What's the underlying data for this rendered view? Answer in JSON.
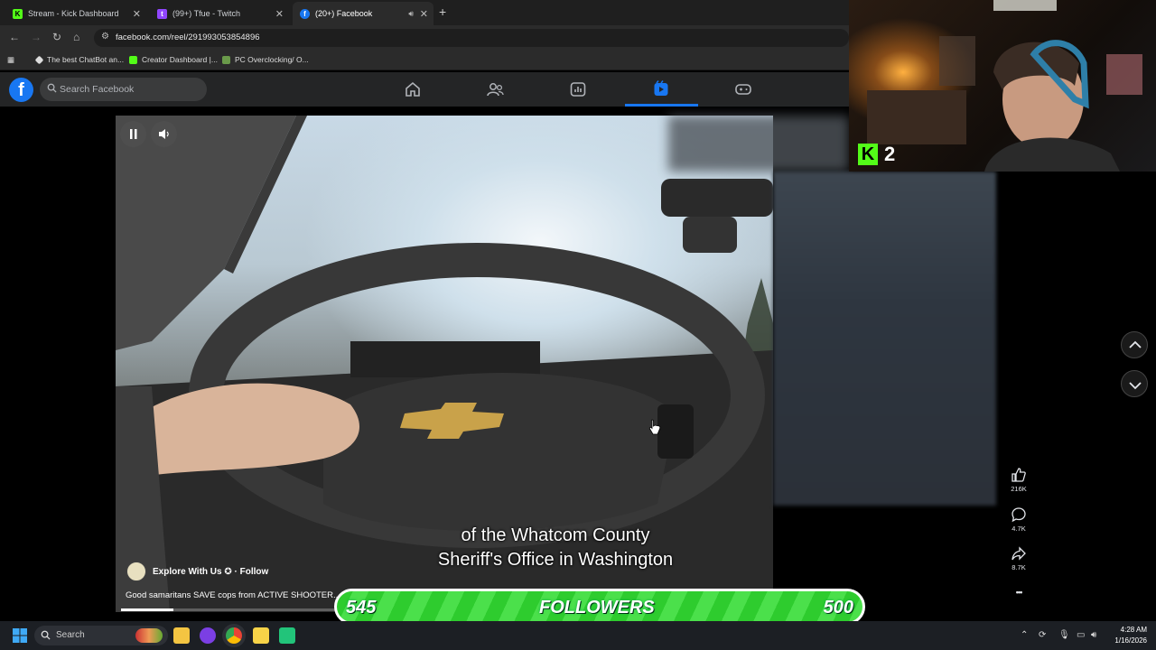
{
  "browser": {
    "tabs": [
      {
        "label": "Stream - Kick Dashboard",
        "favicon_color": "#53fc18"
      },
      {
        "label": "(99+) Tfue - Twitch",
        "favicon_color": "#9146ff"
      },
      {
        "label": "(20+) Facebook",
        "favicon_color": "#1877f2"
      }
    ],
    "new_tab_glyph": "+",
    "url": "facebook.com/reel/291993053854896",
    "bookmarks": [
      {
        "label": "The best ChatBot an...",
        "color": "#ffffff"
      },
      {
        "label": "Creator Dashboard |...",
        "color": "#53fc18"
      },
      {
        "label": "PC Overclocking/ O...",
        "color": "#6a9a4a"
      }
    ]
  },
  "facebook": {
    "logo_letter": "f",
    "search_placeholder": "Search Facebook",
    "nav": [
      "home-icon",
      "friends-icon",
      "dashboard-icon",
      "video-icon",
      "gaming-icon"
    ],
    "active_nav": "video-icon",
    "accent": "#1877f2"
  },
  "reel": {
    "subtitle_line1": "of the Whatcom County",
    "subtitle_line2": "Sheriff's Office in Washington",
    "author": "Explore With Us",
    "verified_glyph": "✪",
    "follow": "· Follow",
    "caption": "Good samaritans SAVE cops from ACTIVE SHOOTER...",
    "progress_fraction": 0.08,
    "likes": "216K",
    "comments": "4.7K",
    "shares": "8.7K",
    "more_glyph": "•••"
  },
  "webcam": {
    "badge_number": "2",
    "badge_letter": "K"
  },
  "goal_bar": {
    "current": "545",
    "label": "FOLLOWERS",
    "target": "500"
  },
  "taskbar": {
    "search_placeholder": "Search",
    "time": "4:28 AM",
    "date": "1/16/2026"
  }
}
